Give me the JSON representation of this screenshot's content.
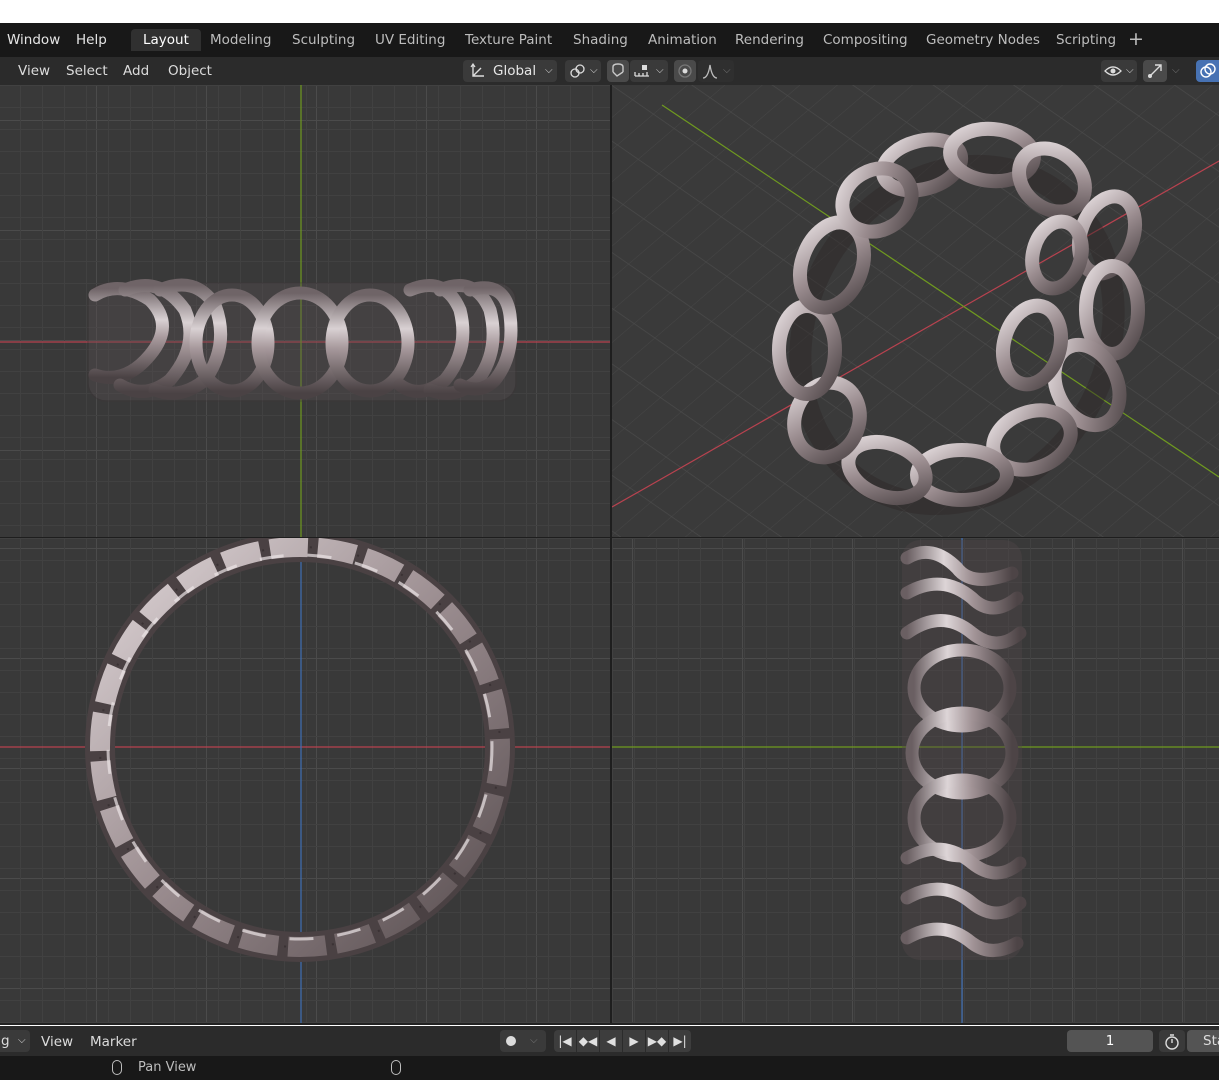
{
  "menubar": {
    "items": [
      {
        "label": "Window"
      },
      {
        "label": "Help"
      }
    ]
  },
  "workspaces": {
    "tabs": [
      {
        "label": "Layout",
        "active": true
      },
      {
        "label": "Modeling"
      },
      {
        "label": "Sculpting"
      },
      {
        "label": "UV Editing"
      },
      {
        "label": "Texture Paint"
      },
      {
        "label": "Shading"
      },
      {
        "label": "Animation"
      },
      {
        "label": "Rendering"
      },
      {
        "label": "Compositing"
      },
      {
        "label": "Geometry Nodes"
      },
      {
        "label": "Scripting"
      }
    ],
    "add_icon": "plus-icon"
  },
  "viewport_header": {
    "menus": [
      {
        "label": "View"
      },
      {
        "label": "Select"
      },
      {
        "label": "Add"
      },
      {
        "label": "Object"
      }
    ],
    "transform_orientation": "Global",
    "icons": [
      "transform-orientation-icon",
      "pivot-point-icon",
      "snap-icon",
      "snap-increment-icon",
      "proportional-edit-icon",
      "falloff-icon",
      "visibility-icon",
      "gizmo-icon",
      "overlay-icon"
    ]
  },
  "colors": {
    "x_axis": "#b8424f",
    "y_axis": "#6f9a1f",
    "z_axis": "#3e6fb5",
    "accent": "#4772b3"
  },
  "timeline": {
    "mode_label": "g",
    "menus": [
      {
        "label": "View"
      },
      {
        "label": "Marker"
      }
    ],
    "current_frame": "1",
    "start_label": "Sta",
    "playback_icons": [
      "record-icon",
      "jump-start-icon",
      "prev-keyframe-icon",
      "play-reverse-icon",
      "play-icon",
      "next-keyframe-icon",
      "jump-end-icon"
    ]
  },
  "statusbar": {
    "hint": "Pan View"
  }
}
